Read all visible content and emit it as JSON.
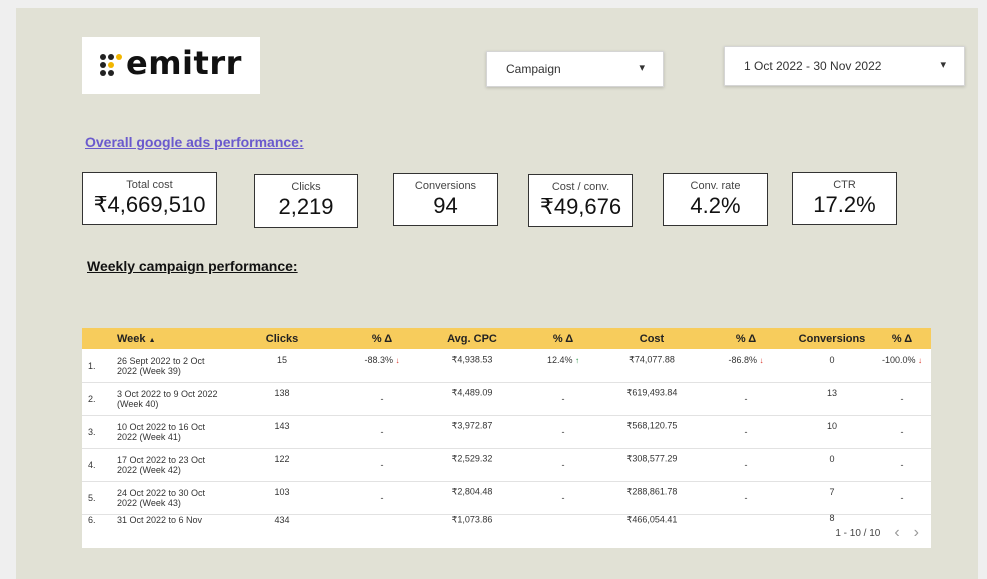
{
  "logo": {
    "text": "emitrr"
  },
  "filters": {
    "campaign_label": "Campaign",
    "date_range": "1 Oct 2022 - 30 Nov 2022",
    "caret": "▾"
  },
  "overall_link": "Overall google ads performance:",
  "weekly_heading": "Weekly campaign performance:",
  "kpis": [
    {
      "label": "Total cost",
      "value": "₹4,669,510"
    },
    {
      "label": "Clicks",
      "value": "2,219"
    },
    {
      "label": "Conversions",
      "value": "94"
    },
    {
      "label": "Cost / conv.",
      "value": "₹49,676"
    },
    {
      "label": "Conv. rate",
      "value": "4.2%"
    },
    {
      "label": "CTR",
      "value": "17.2%"
    }
  ],
  "table": {
    "headers": {
      "week": "Week",
      "sort_icon": "▲",
      "clicks": "Clicks",
      "delta": "% Δ",
      "avg_cpc": "Avg. CPC",
      "cost": "Cost",
      "conversions": "Conversions"
    },
    "rows": [
      {
        "num": "1.",
        "week": "26 Sept 2022 to 2 Oct 2022 (Week 39)",
        "clicks": "15",
        "clicks_delta": "-88.3%",
        "clicks_dir": "↓",
        "cpc": "₹4,938.53",
        "cpc_delta": "12.4%",
        "cpc_dir": "↑",
        "cost": "₹74,077.88",
        "cost_delta": "-86.8%",
        "cost_dir": "↓",
        "conv": "0",
        "conv_delta": "-100.0%",
        "conv_dir": "↓"
      },
      {
        "num": "2.",
        "week": "3 Oct 2022 to 9 Oct 2022 (Week 40)",
        "clicks": "138",
        "clicks_delta": "-",
        "clicks_dir": "",
        "cpc": "₹4,489.09",
        "cpc_delta": "-",
        "cpc_dir": "",
        "cost": "₹619,493.84",
        "cost_delta": "-",
        "cost_dir": "",
        "conv": "13",
        "conv_delta": "-",
        "conv_dir": ""
      },
      {
        "num": "3.",
        "week": "10 Oct 2022 to 16 Oct 2022 (Week 41)",
        "clicks": "143",
        "clicks_delta": "-",
        "clicks_dir": "",
        "cpc": "₹3,972.87",
        "cpc_delta": "-",
        "cpc_dir": "",
        "cost": "₹568,120.75",
        "cost_delta": "-",
        "cost_dir": "",
        "conv": "10",
        "conv_delta": "-",
        "conv_dir": ""
      },
      {
        "num": "4.",
        "week": "17 Oct 2022 to 23 Oct 2022 (Week 42)",
        "clicks": "122",
        "clicks_delta": "-",
        "clicks_dir": "",
        "cpc": "₹2,529.32",
        "cpc_delta": "-",
        "cpc_dir": "",
        "cost": "₹308,577.29",
        "cost_delta": "-",
        "cost_dir": "",
        "conv": "0",
        "conv_delta": "-",
        "conv_dir": ""
      },
      {
        "num": "5.",
        "week": "24 Oct 2022 to 30 Oct 2022 (Week 43)",
        "clicks": "103",
        "clicks_delta": "-",
        "clicks_dir": "",
        "cpc": "₹2,804.48",
        "cpc_delta": "-",
        "cpc_dir": "",
        "cost": "₹288,861.78",
        "cost_delta": "-",
        "cost_dir": "",
        "conv": "7",
        "conv_delta": "-",
        "conv_dir": ""
      },
      {
        "num": "6.",
        "week": "31 Oct 2022 to 6 Nov",
        "clicks": "434",
        "clicks_delta": "",
        "clicks_dir": "",
        "cpc": "₹1,073.86",
        "cpc_delta": "",
        "cpc_dir": "",
        "cost": "₹466,054.41",
        "cost_delta": "",
        "cost_dir": "",
        "conv": "8",
        "conv_delta": "",
        "conv_dir": ""
      }
    ],
    "pagination": {
      "range": "1 - 10 / 10",
      "prev": "‹",
      "next": "›"
    }
  }
}
